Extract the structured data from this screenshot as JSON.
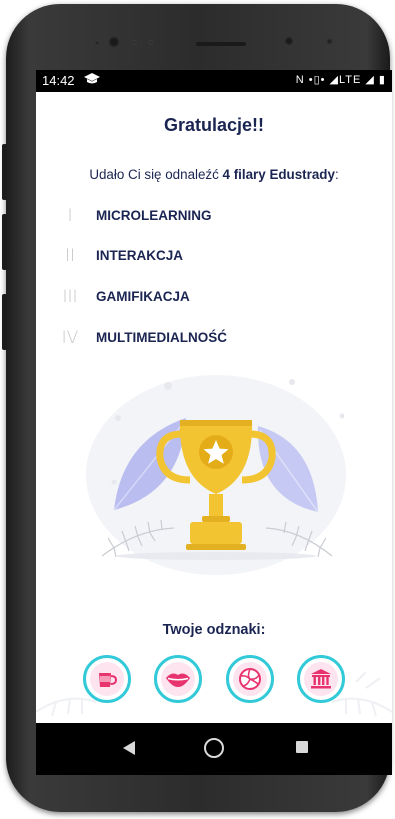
{
  "status_bar": {
    "time": "14:42",
    "right_icons": "N  •▯•  ◢LTE ◢ ▮"
  },
  "screen": {
    "title": "Gratulacje!!",
    "intro_prefix": "Udało Ci się odnaleźć ",
    "intro_bold": "4 filary Edustrady",
    "intro_suffix": ":",
    "pillars": [
      {
        "numeral": "I",
        "label": "MICROLEARNING"
      },
      {
        "numeral": "II",
        "label": "INTERAKCJA"
      },
      {
        "numeral": "III",
        "label": "GAMIFIKACJA"
      },
      {
        "numeral": "IV",
        "label": "MULTIMEDIALNOŚĆ"
      }
    ],
    "badges_title": "Twoje odznaki:",
    "badges": [
      {
        "icon": "cup-icon"
      },
      {
        "icon": "lips-icon"
      },
      {
        "icon": "volleyball-icon"
      },
      {
        "icon": "building-icon"
      }
    ]
  },
  "colors": {
    "text_dark": "#1b2552",
    "badge_ring": "#32c9d8",
    "badge_accent": "#e8346e",
    "trophy": "#f2c431"
  }
}
